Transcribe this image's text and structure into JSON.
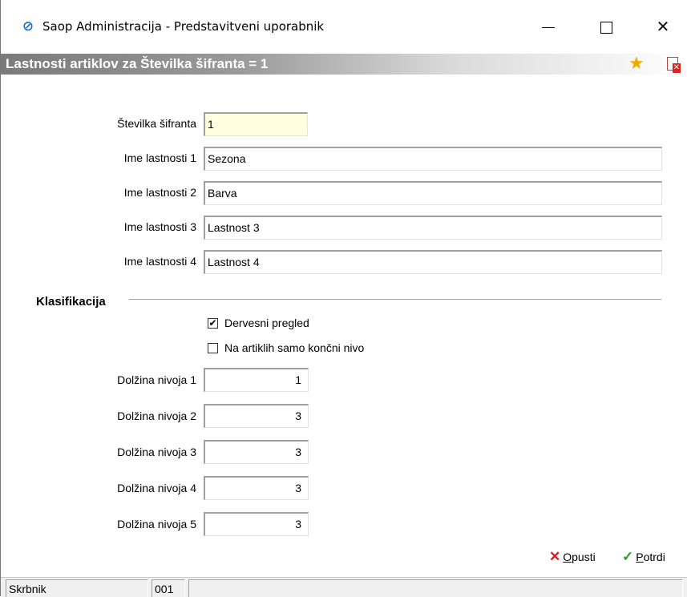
{
  "window": {
    "title": "Saop Administracija - Predstavitveni uporabnik",
    "app_icon": "saop-logo-icon",
    "controls": {
      "minimize": "minimize",
      "maximize": "maximize",
      "close": "close"
    }
  },
  "header": {
    "title": "Lastnosti artiklov za Številka šifranta = 1",
    "icons": [
      "star-icon",
      "delete-document-icon"
    ],
    "colors": {
      "gradient_start": "#7a7a7a",
      "gradient_end": "#ffffff",
      "star": "#f6a800"
    }
  },
  "form": {
    "fields": [
      {
        "label": "Številka šifranta",
        "value": "1"
      },
      {
        "label": "Ime lastnosti 1",
        "value": "Sezona"
      },
      {
        "label": "Ime lastnosti 2",
        "value": "Barva"
      },
      {
        "label": "Ime lastnosti 3",
        "value": "Lastnost 3"
      },
      {
        "label": "Ime lastnosti 4",
        "value": "Lastnost 4"
      }
    ],
    "highlight_color": "#ffffe1"
  },
  "klasifikacija": {
    "title": "Klasifikacija",
    "checkboxes": [
      {
        "label": "Dervesni pregled",
        "checked": true
      },
      {
        "label": "Na artiklih samo končni nivo",
        "checked": false
      }
    ],
    "levels": [
      {
        "label": "Dolžina nivoja 1",
        "value": "1"
      },
      {
        "label": "Dolžina nivoja 2",
        "value": "3"
      },
      {
        "label": "Dolžina nivoja 3",
        "value": "3"
      },
      {
        "label": "Dolžina nivoja 4",
        "value": "3"
      },
      {
        "label": "Dolžina nivoja 5",
        "value": "3"
      }
    ]
  },
  "buttons": {
    "cancel": {
      "mnemonic": "O",
      "rest": "pusti",
      "icon": "cancel-x-icon",
      "color": "#d02020"
    },
    "confirm": {
      "mnemonic": "P",
      "rest": "otrdi",
      "icon": "checkmark-icon",
      "color": "#2e9b2e"
    }
  },
  "statusbar": {
    "user": "Skrbnik",
    "code": "001",
    "extra": ""
  }
}
